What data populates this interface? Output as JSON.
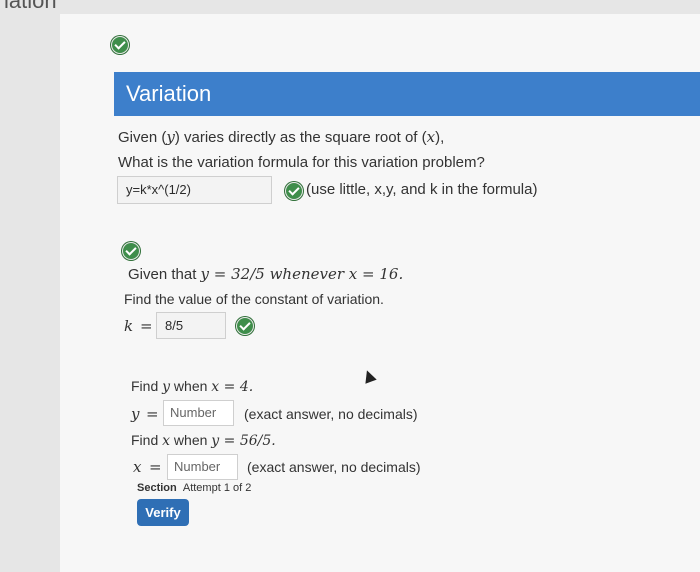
{
  "top_fragment": "iation",
  "header": {
    "title": "Variation"
  },
  "problem1": {
    "line1_prefix": "Given (",
    "line1_y": "y",
    "line1_middle": ") varies directly as the square root of (",
    "line1_x": "x",
    "line1_suffix": "),",
    "line2": "What is the variation formula for this variation problem?",
    "answer_value": "y=k*x^(1/2)",
    "hint": "(use little, x,y, and k in the formula)"
  },
  "problem2": {
    "given_prefix": "Given that ",
    "given_y": "y",
    "given_eq1": " = 32/5 whenever ",
    "given_x": "x",
    "given_eq2": " = 16.",
    "find_k": "Find the value of the constant of variation.",
    "k_label": "k",
    "equals": "=",
    "k_value": "8/5"
  },
  "problem3": {
    "find_y_prefix": "Find ",
    "find_y_var": "y",
    "find_y_mid": " when ",
    "find_y_x": "x",
    "find_y_eq": " = 4.",
    "y_label": "y",
    "y_placeholder": "Number",
    "y_hint": "(exact answer, no decimals)",
    "find_x_prefix": "Find ",
    "find_x_var": "x",
    "find_x_mid": " when ",
    "find_x_y": "y",
    "find_x_eq": " = 56/5.",
    "x_label": "x",
    "x_placeholder": "Number",
    "x_hint": "(exact answer, no decimals)"
  },
  "section": {
    "label": "Section",
    "attempt": "Attempt 1 of 2"
  },
  "verify_label": "Verify",
  "colors": {
    "header": "#3d7fcb",
    "check": "#3f8e4b",
    "button": "#2f6fb5"
  }
}
